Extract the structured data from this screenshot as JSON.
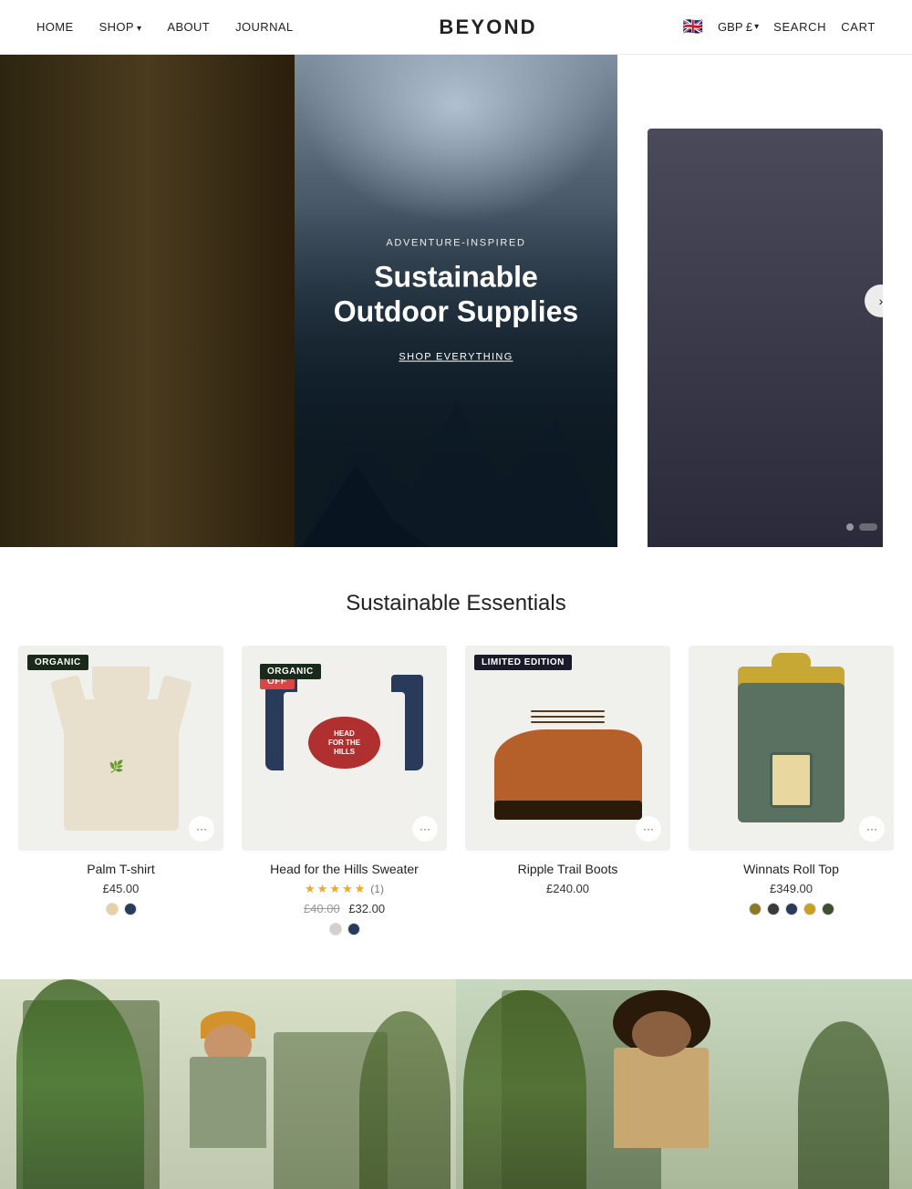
{
  "nav": {
    "links": [
      {
        "label": "HOME",
        "id": "home"
      },
      {
        "label": "SHOP",
        "id": "shop",
        "hasDropdown": true
      },
      {
        "label": "ABOUT",
        "id": "about"
      },
      {
        "label": "JOURNAL",
        "id": "journal"
      }
    ],
    "logo": "BEYOND",
    "right": {
      "currency": "GBP £",
      "search": "SEARCH",
      "cart": "CART"
    }
  },
  "hero": {
    "subtitle": "ADVENTURE-INSPIRED",
    "title": "Sustainable Outdoor Supplies",
    "cta": "SHOP EVERYTHING",
    "dots": [
      "inactive",
      "active",
      "inactive"
    ]
  },
  "products_section": {
    "title": "Sustainable Essentials",
    "items": [
      {
        "id": "palm-tshirt",
        "name": "Palm T-shirt",
        "price": "£45.00",
        "badges": [
          {
            "label": "ORGANIC",
            "type": "organic"
          }
        ],
        "colors": [
          "#e8d8b0",
          "#2a3a5a"
        ],
        "type": "tshirt"
      },
      {
        "id": "hills-sweater",
        "name": "Head for the Hills Sweater",
        "price": "£32.00",
        "original_price": "£40.00",
        "stars": 5,
        "review_count": "(1)",
        "badges": [
          {
            "label": "20% OFF",
            "type": "20off"
          },
          {
            "label": "ORGANIC",
            "type": "organic"
          }
        ],
        "colors": [
          "#d0d0cc",
          "#2a3a5a"
        ],
        "type": "sweater"
      },
      {
        "id": "ripple-boots",
        "name": "Ripple Trail Boots",
        "price": "£240.00",
        "badges": [
          {
            "label": "LIMITED EDITION",
            "type": "limited"
          }
        ],
        "colors": [],
        "type": "boots"
      },
      {
        "id": "winnats-pack",
        "name": "Winnats Roll Top",
        "price": "£349.00",
        "badges": [],
        "colors": [
          "#8a7a2a",
          "#3a3a3a",
          "#2a3a5a",
          "#c8a020",
          "#3a5030"
        ],
        "type": "backpack"
      }
    ]
  },
  "bottom_banners": [
    {
      "id": "banner-left",
      "bg": "light-green"
    },
    {
      "id": "banner-right",
      "bg": "medium-green"
    }
  ],
  "icons": {
    "chevron_down": "▾",
    "chevron_right": "›",
    "three_dots": "•••"
  }
}
